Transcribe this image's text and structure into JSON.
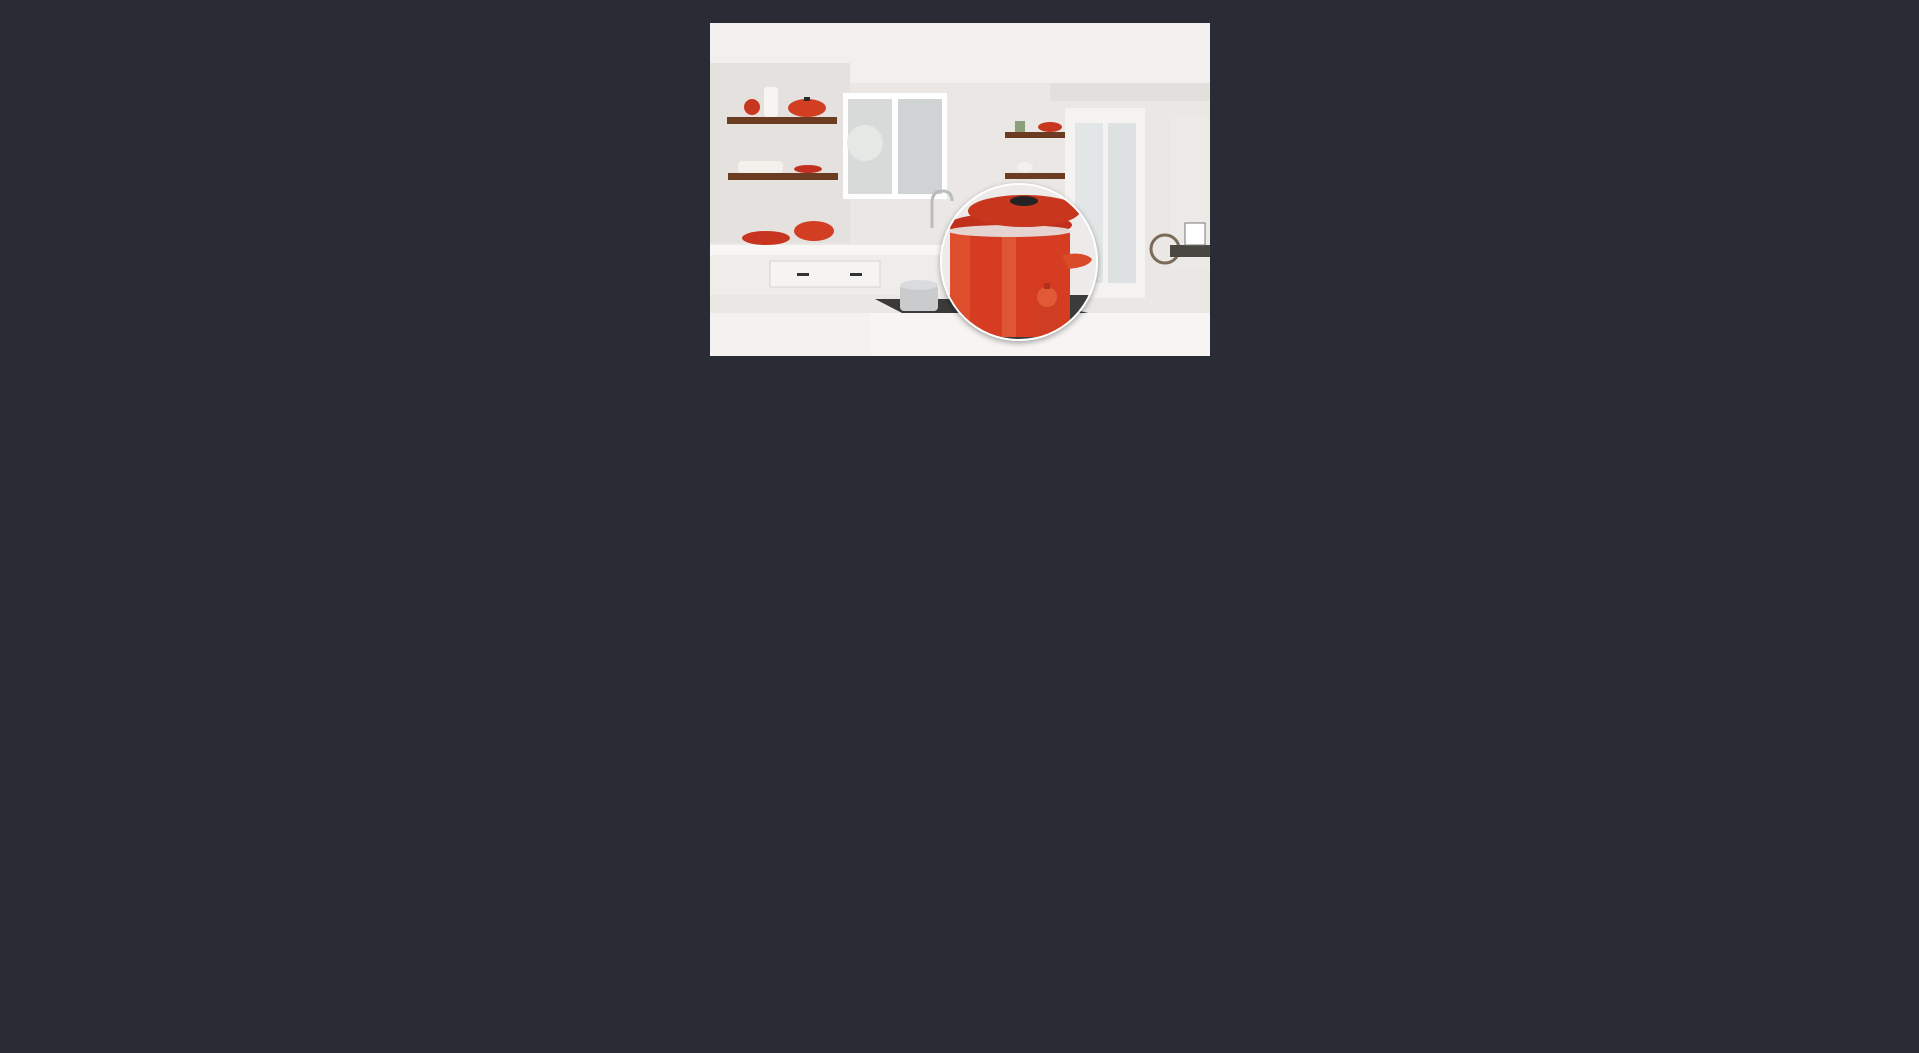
{
  "viewer": {
    "background_color": "#292c35",
    "image": {
      "subject": "kitchen-photo",
      "accent_color": "#d9402b"
    },
    "magnifier": {
      "icon": "magnifier-lens",
      "border_color": "#ffffff"
    }
  }
}
